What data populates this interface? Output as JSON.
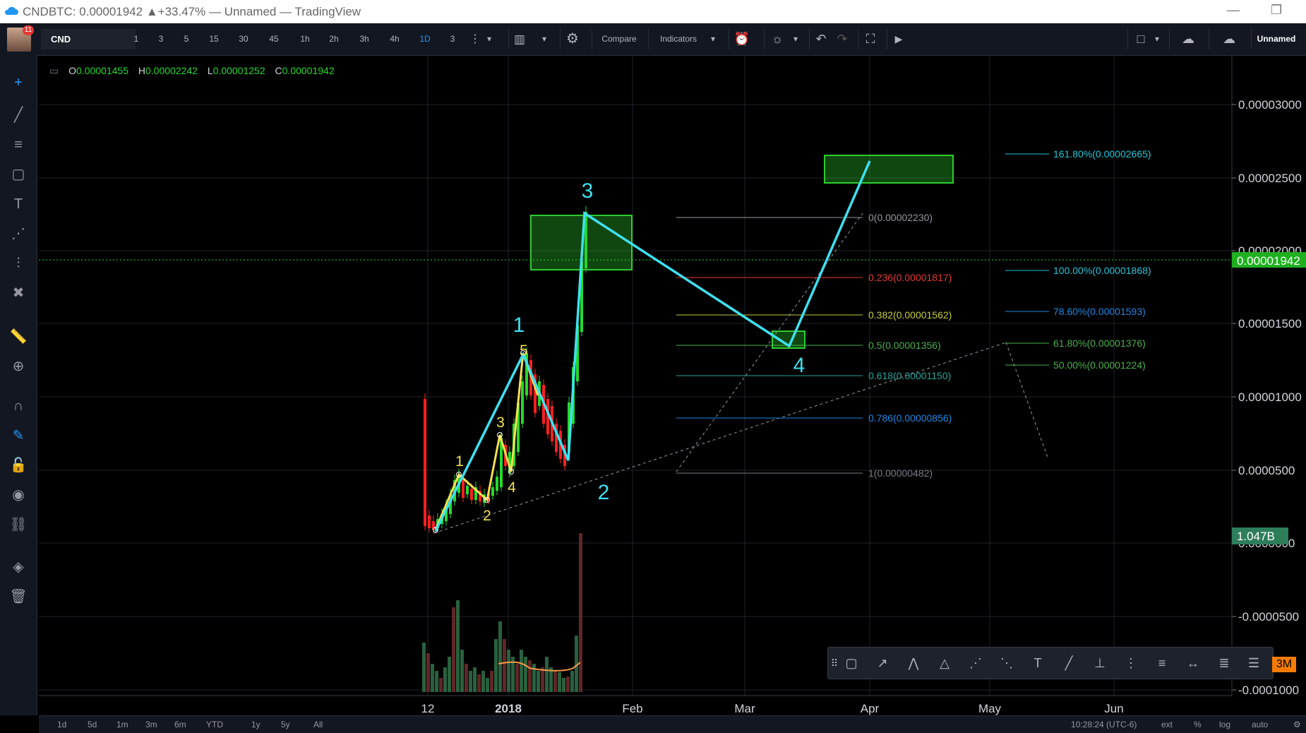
{
  "window": {
    "title": "CNDBTC: 0.00001942 ▲+33.47% — Unnamed — TradingView",
    "minimize_icon": "minimize-icon",
    "restore_icon": "restore-icon"
  },
  "toolbar": {
    "avatar_badge": "11",
    "symbol": "CND",
    "intervals": [
      "1",
      "3",
      "5",
      "15",
      "30",
      "45",
      "1h",
      "2h",
      "3h",
      "4h",
      "1D",
      "3"
    ],
    "active_interval": "1D",
    "compare": "Compare",
    "indicators": "Indicators",
    "layout_name": "Unnamed"
  },
  "legend": {
    "o_label": "O",
    "o_value": "0.00001455",
    "h_label": "H",
    "h_value": "0.00002242",
    "l_label": "L",
    "l_value": "0.00001252",
    "c_label": "C",
    "c_value": "0.00001942"
  },
  "price_axis": {
    "ticks": [
      "0.00003000",
      "0.00002500",
      "0.00002000",
      "0.00001500",
      "0.00001000",
      "0.0000500",
      "0.0000000",
      "-0.0000500",
      "-0.0001000"
    ],
    "current_price": "0.00001942",
    "volume_label": "1.047B"
  },
  "time_axis": {
    "ticks": [
      "12",
      "2018",
      "Feb",
      "Mar",
      "Apr",
      "May",
      "Jun"
    ]
  },
  "fib_retracement": [
    {
      "label": "0(0.00002230)",
      "color": "#9598a1"
    },
    {
      "label": "0.236(0.00001817)",
      "color": "#e53935"
    },
    {
      "label": "0.382(0.00001562)",
      "color": "#c5cc3a"
    },
    {
      "label": "0.5(0.00001356)",
      "color": "#4caf50"
    },
    {
      "label": "0.618(0.00001150)",
      "color": "#26a69a"
    },
    {
      "label": "0.786(0.00000856)",
      "color": "#1e88e5"
    },
    {
      "label": "1(0.00000482)",
      "color": "#787b86"
    }
  ],
  "fib_extension": [
    {
      "label": "161.80%(0.00002665)",
      "color": "#26c6da"
    },
    {
      "label": "100.00%(0.00001868)",
      "color": "#26c6da"
    },
    {
      "label": "78.60%(0.00001593)",
      "color": "#1e88e5"
    },
    {
      "label": "61.80%(0.00001376)",
      "color": "#4caf50"
    },
    {
      "label": "50.00%(0.00001224)",
      "color": "#4caf50"
    }
  ],
  "waves": {
    "major": [
      "1",
      "2",
      "3",
      "4"
    ],
    "minor": [
      "1",
      "2",
      "3",
      "4",
      "5"
    ]
  },
  "colors": {
    "wave_line": "#3ee0f0",
    "minor_wave": "#f5e052",
    "box": "#2ecc2e",
    "up": "#26d92c",
    "down": "#ff1f1f"
  },
  "bottom": {
    "ranges": [
      "1d",
      "5d",
      "1m",
      "3m",
      "6m",
      "YTD",
      "1y",
      "5y",
      "All"
    ],
    "time": "10:28:24 (UTC-6)",
    "ext": "ext",
    "pct": "%",
    "log": "log",
    "auto": "auto"
  },
  "float_toolbar": {
    "badge": "3M"
  }
}
